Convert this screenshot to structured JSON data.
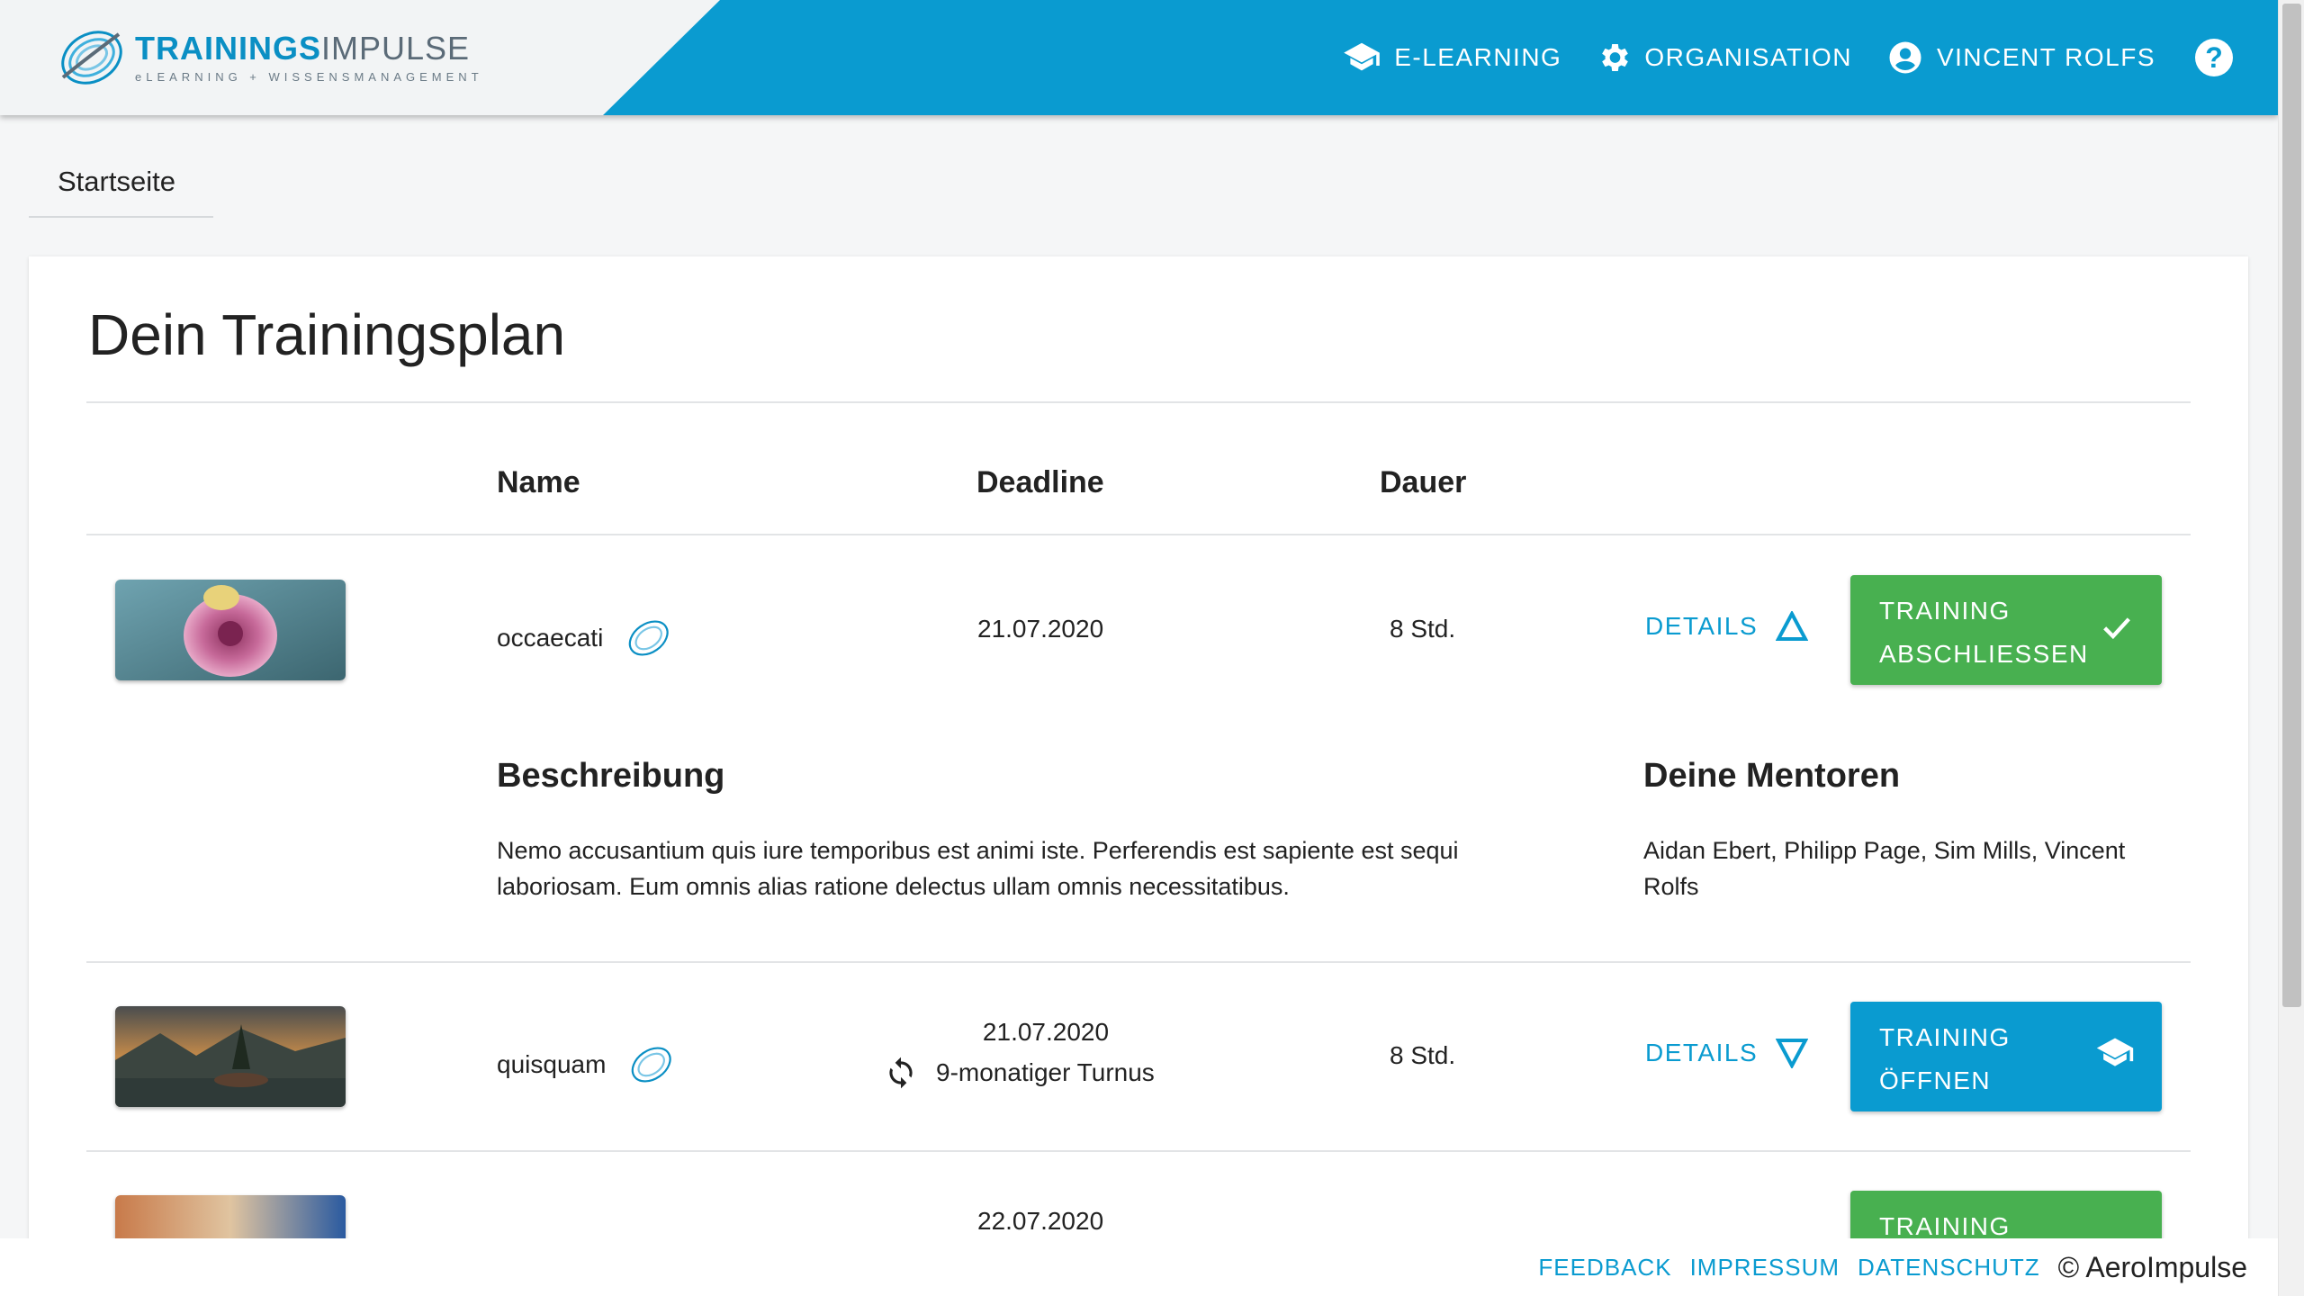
{
  "header": {
    "logo_bold": "TRAININGS",
    "logo_light": "IMPULSE",
    "logo_sub": "eLEARNING + WISSENSMANAGEMENT",
    "nav": [
      {
        "label": "E-LEARNING",
        "icon": "graduation-cap-icon"
      },
      {
        "label": "ORGANISATION",
        "icon": "gear-icon"
      },
      {
        "label": "VINCENT ROLFS",
        "icon": "account-circle-icon"
      }
    ],
    "help_label": "?"
  },
  "breadcrumb": {
    "label": "Startseite"
  },
  "main": {
    "title": "Dein Trainingsplan",
    "columns": {
      "name": "Name",
      "deadline": "Deadline",
      "duration": "Dauer"
    },
    "rows": [
      {
        "name": "occaecati",
        "deadline": "21.07.2020",
        "duration": "8 Std.",
        "details_label": "DETAILS",
        "action_line1": "TRAINING",
        "action_line2": "ABSCHLIESSEN",
        "action_icon": "check-icon",
        "expanded": true,
        "description_title": "Beschreibung",
        "description_line1": "Nemo accusantium quis iure temporibus est animi iste. Perferendis est sapiente est sequi",
        "description_line2": "laboriosam. Eum omnis alias ratione delectus ullam omnis necessitatibus.",
        "mentors_title": "Deine Mentoren",
        "mentors_line1": "Aidan Ebert, Philipp Page, Sim Mills, Vincent",
        "mentors_line2": "Rolfs"
      },
      {
        "name": "quisquam",
        "deadline": "21.07.2020",
        "turnus": "9-monatiger Turnus",
        "duration": "8 Std.",
        "details_label": "DETAILS",
        "action_line1": "TRAINING",
        "action_line2": "ÖFFNEN",
        "action_icon": "graduation-cap-icon"
      },
      {
        "deadline": "22.07.2020",
        "action_line1": "TRAINING"
      }
    ]
  },
  "footer": {
    "links": [
      "FEEDBACK",
      "IMPRESSUM",
      "DATENSCHUTZ"
    ],
    "copyright": "© AeroImpulse"
  },
  "colors": {
    "brand": "#0a9bd0",
    "success": "#48b050"
  }
}
